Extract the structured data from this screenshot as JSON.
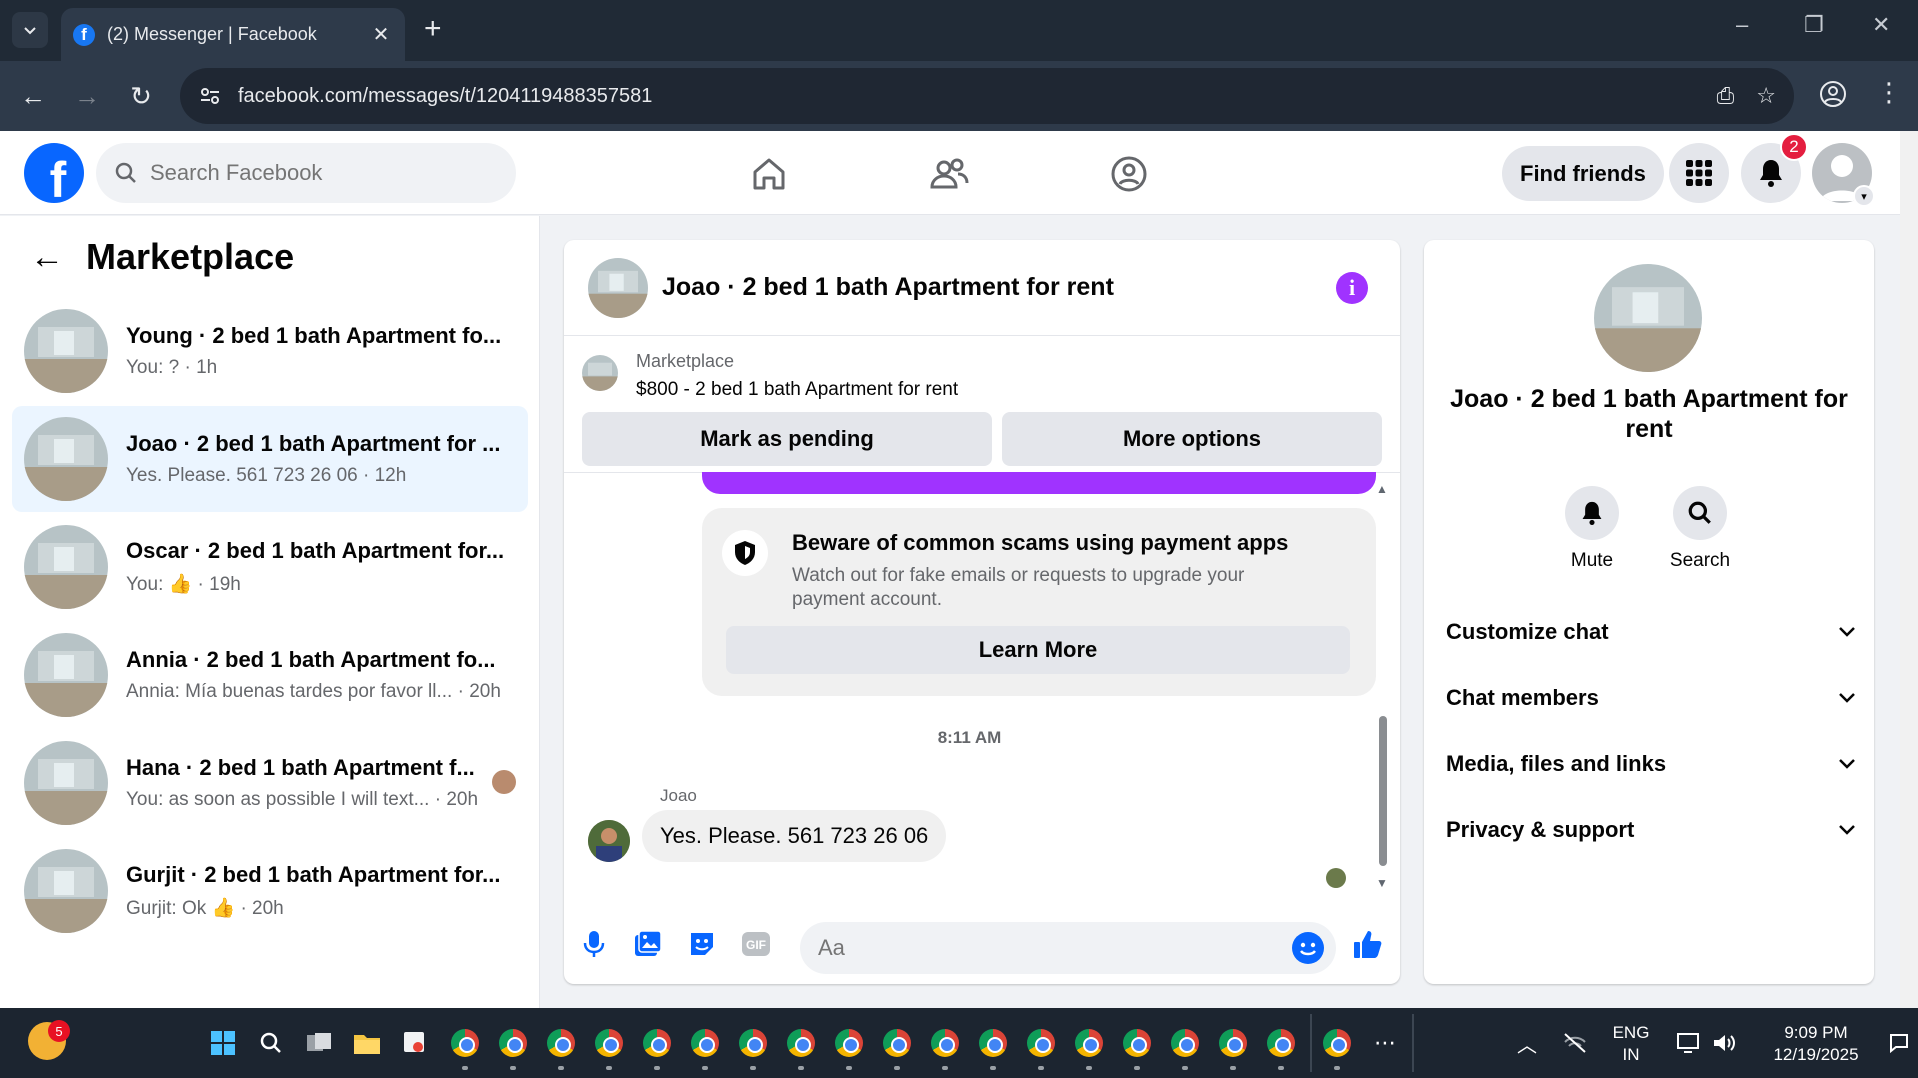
{
  "browser": {
    "tab_title": "(2) Messenger | Facebook",
    "url": "facebook.com/messages/t/1204119488357581"
  },
  "fb": {
    "search_placeholder": "Search Facebook",
    "find_friends": "Find friends",
    "notification_count": "2"
  },
  "left": {
    "title": "Marketplace",
    "chats": [
      {
        "name": "Young · 2 bed 1 bath Apartment fo...",
        "sub": "You: ? · 1h"
      },
      {
        "name": "Joao · 2 bed 1 bath Apartment for ...",
        "sub": "Yes. Please. 561 723 26 06 · 12h"
      },
      {
        "name": "Oscar · 2 bed 1 bath Apartment for...",
        "sub": "You: 👍 · 19h"
      },
      {
        "name": "Annia · 2 bed 1 bath Apartment fo...",
        "sub": "Annia: Mía buenas tardes por favor ll... · 20h"
      },
      {
        "name": "Hana · 2 bed 1 bath Apartment f...",
        "sub": "You: as soon as possible I will text... · 20h"
      },
      {
        "name": "Gurjit · 2 bed 1 bath Apartment for...",
        "sub": "Gurjit: Ok 👍 · 20h"
      }
    ]
  },
  "chat": {
    "title": "Joao · 2 bed 1 bath Apartment for rent",
    "marketplace_label": "Marketplace",
    "listing": "$800 - 2 bed 1 bath Apartment for rent",
    "mark_pending": "Mark as pending",
    "more_options": "More options",
    "scam_title": "Beware of common scams using payment apps",
    "scam_body": "Watch out for fake emails or requests to upgrade your payment account.",
    "learn_more": "Learn More",
    "timestamp": "8:11 AM",
    "sender": "Joao",
    "message": "Yes. Please. 561 723 26 06",
    "input_placeholder": "Aa"
  },
  "right": {
    "title": "Joao · 2 bed 1 bath Apartment for rent",
    "mute": "Mute",
    "search": "Search",
    "rows": [
      "Customize chat",
      "Chat members",
      "Media, files and links",
      "Privacy & support"
    ]
  },
  "taskbar": {
    "weather_badge": "5",
    "lang_line1": "ENG",
    "lang_line2": "IN",
    "time": "9:09 PM",
    "date": "12/19/2025"
  },
  "colors": {
    "fb_blue": "#0866ff",
    "active_chat_bg": "#ebf5ff",
    "accent_purple": "#a033ff",
    "badge_red": "#e41e3f"
  }
}
